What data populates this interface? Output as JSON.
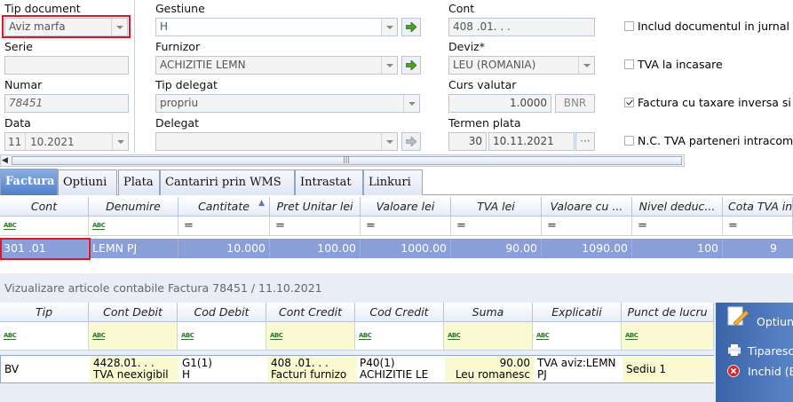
{
  "form": {
    "tip_document": {
      "label": "Tip document",
      "value": "Aviz marfa"
    },
    "serie": {
      "label": "Serie",
      "value": ""
    },
    "numar": {
      "label": "Numar",
      "value": "78451"
    },
    "data": {
      "label": "Data",
      "day": "11",
      "rest": "10.2021"
    },
    "gestiune": {
      "label": "Gestiune",
      "value": "H"
    },
    "furnizor": {
      "label": "Furnizor",
      "value": "ACHIZITIE LEMN"
    },
    "tip_delegat": {
      "label": "Tip delegat",
      "value": "propriu"
    },
    "delegat": {
      "label": "Delegat",
      "value": ""
    },
    "cont": {
      "label": "Cont",
      "value": "408 .01.  .  ."
    },
    "deviz": {
      "label": "Deviz*",
      "value": "LEU (ROMANIA)"
    },
    "curs_valutar": {
      "label": "Curs valutar",
      "value": "1.0000",
      "bnr": "BNR"
    },
    "termen_plata": {
      "label": "Termen plata",
      "days": "30",
      "date": "10.11.2021",
      "btn": "···"
    }
  },
  "checkboxes": [
    {
      "label": "Includ documentul in jurnal T",
      "checked": false
    },
    {
      "label": "TVA la incasare",
      "checked": false
    },
    {
      "label": "Factura cu taxare inversa si",
      "checked": true
    },
    {
      "label": "N.C. TVA parteneri intracomu",
      "checked": false
    }
  ],
  "scroll_glyph": "|||",
  "tabs": [
    "Factura",
    "Optiuni",
    "Plata",
    "Cantariri prin WMS",
    "Intrastat",
    "Linkuri"
  ],
  "items_grid": {
    "headers": [
      "Cont",
      "Denumire",
      "Cantitate",
      "Pret Unitar lei",
      "Valoare lei",
      "TVA lei",
      "Valoare cu ...",
      "Nivel deduc...",
      "Cota TVA in"
    ],
    "row": [
      "301 .01",
      "LEMN PJ",
      "10.000",
      "100.00",
      "1000.00",
      "90.00",
      "1090.00",
      "100",
      "9"
    ]
  },
  "accounting": {
    "title": "Vizualizare articole contabile Factura 78451 / 11.10.2021",
    "headers": [
      "Tip",
      "Cont Debit",
      "Cod Debit",
      "Cont Credit",
      "Cod Credit",
      "Suma",
      "Explicatii",
      "Punct de lucru"
    ],
    "row": {
      "tip": "BV",
      "cont_debit": [
        "4428.01.  .  .",
        "TVA neexigibil"
      ],
      "cod_debit": [
        "G1(1)",
        "H"
      ],
      "cont_credit": [
        "408 .01.  .  .",
        "Facturi furnizo"
      ],
      "cod_credit": [
        "P40(1)",
        "ACHIZITIE LE"
      ],
      "suma": [
        "90.00",
        "Leu romanesc"
      ],
      "explicatii": [
        "TVA aviz:LEMN",
        "PJ"
      ],
      "punct": "Sediu 1"
    }
  },
  "side_buttons": [
    "Optiun",
    "Tiparesc",
    "Inchid (E"
  ],
  "colors": {
    "accent": "#4f7fcc",
    "selected_row": "#8a9fd8",
    "highlight": "#e01620",
    "side_panel": "#3a63a8"
  }
}
